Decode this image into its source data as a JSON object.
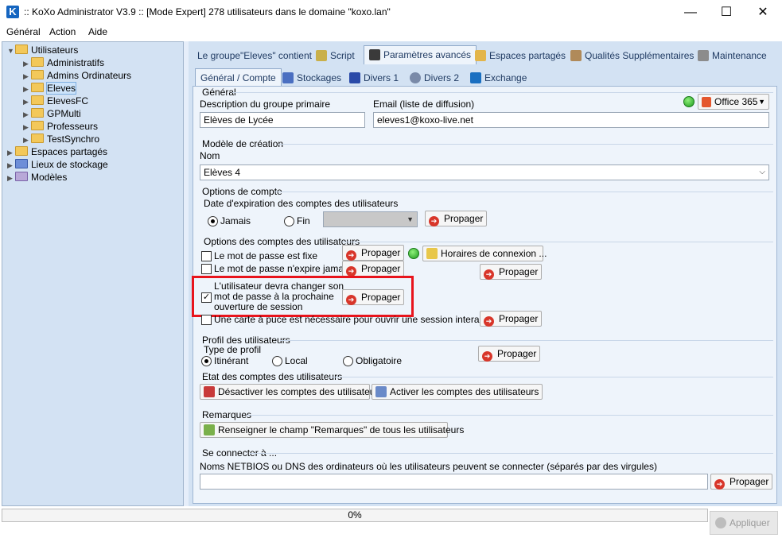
{
  "window": {
    "title": ":: KoXo Administrator V3.9 :: [Mode Expert] 278 utilisateurs dans le domaine \"koxo.lan\"",
    "app_icon_letter": "K",
    "minimize": "—",
    "maximize": "☐",
    "close": "✕"
  },
  "menu": [
    "Général",
    "Action",
    "Aide"
  ],
  "tree": {
    "root": "Utilisateurs",
    "children": [
      "Administratifs",
      "Admins Ordinateurs",
      "Eleves",
      "ElevesFC",
      "GPMulti",
      "Professeurs",
      "TestSynchro"
    ],
    "selected": "Eleves",
    "others": [
      "Espaces partagés",
      "Lieux de stockage",
      "Modèles"
    ]
  },
  "tabs_top": [
    "Le groupe\"Eleves\" contient",
    "Script",
    "Paramètres avancés",
    "Espaces partagés",
    "Qualités Supplémentaires",
    "Maintenance"
  ],
  "tabs_sub": [
    "Général / Compte",
    "Stockages",
    "Divers 1",
    "Divers 2",
    "Exchange"
  ],
  "general": {
    "section": "Général",
    "desc_label": "Description du groupe primaire",
    "desc_value": "Elèves de Lycée",
    "email_label": "Email (liste de diffusion)",
    "email_value": "eleves1@koxo-live.net",
    "office_label": "Office 365"
  },
  "modele": {
    "section": "Modèle de création",
    "nom_label": "Nom",
    "nom_value": "Elèves 4"
  },
  "compte": {
    "section": "Options de compte",
    "expiration_label": "Date d'expiration des comptes des utilisateurs",
    "jamais": "Jamais",
    "fin": "Fin",
    "fin_value": ""
  },
  "options": {
    "section": "Options des comptes des utilisateurs",
    "pwd_fixed": "Le mot de passe est fixe",
    "pwd_never_expires": "Le mot de passe n'expire jamais",
    "change_pwd_line1": "L'utilisateur devra changer son",
    "change_pwd_line2": "mot de passe à la prochaine",
    "change_pwd_line3": "ouverture de session",
    "smartcard": "Une carte à puce est nécessaire pour ouvrir une session interactive",
    "horaires": "Horaires de connexion ..."
  },
  "profil": {
    "section": "Profil des utilisateurs",
    "type_label": "Type de profil",
    "itinerant": "Itinérant",
    "local": "Local",
    "obligatoire": "Obligatoire"
  },
  "etat": {
    "section": "Etat des comptes des utilisateurs",
    "disable": "Désactiver les comptes des utilisateurs",
    "enable": "Activer les comptes des utilisateurs"
  },
  "remarques": {
    "section": "Remarques",
    "button": "Renseigner le champ \"Remarques\" de tous les utilisateurs"
  },
  "connect": {
    "section": "Se connecter à ...",
    "label": "Noms NETBIOS ou DNS des ordinateurs où les utilisateurs peuvent se connecter (séparés par des virgules)",
    "value": ""
  },
  "propager": "Propager",
  "status": {
    "progress_text": "0%",
    "progress_value": 0,
    "apply": "Appliquer"
  },
  "colors": {
    "highlight": "#e8141c",
    "tree_bg": "#d3e2f3",
    "panel_bg": "#eef4fb"
  }
}
